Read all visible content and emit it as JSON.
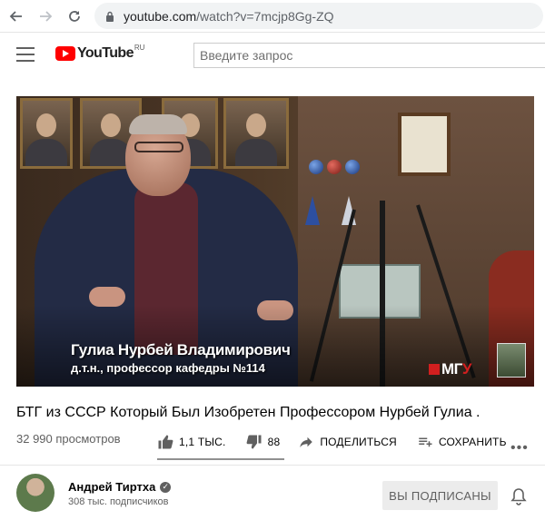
{
  "browser": {
    "url_host": "youtube.com",
    "url_path": "/watch?v=7mcjp8Gg-ZQ"
  },
  "header": {
    "logo_text": "YouTube",
    "logo_region": "RU",
    "search_placeholder": "Введите запрос"
  },
  "video": {
    "overlay_name": "Гулиа Нурбей Владимирович",
    "overlay_title": "д.т.н., профессор кафедры  №114",
    "watermark_text_white": "МГ",
    "watermark_text_red": "У"
  },
  "meta": {
    "title": "БТГ из СССР Который Был Изобретен Профессором Нурбей Гулиа .",
    "views": "32 990 просмотров",
    "likes": "1,1 ТЫС.",
    "dislikes": "88",
    "share_label": "ПОДЕЛИТЬСЯ",
    "save_label": "СОХРАНИТЬ",
    "more_label": "•••"
  },
  "channel": {
    "name": "Андрей Тиртха",
    "verified_mark": "✓",
    "subscribers": "308 тыс. подписчиков",
    "subscribed_label": "ВЫ ПОДПИСАНЫ"
  }
}
